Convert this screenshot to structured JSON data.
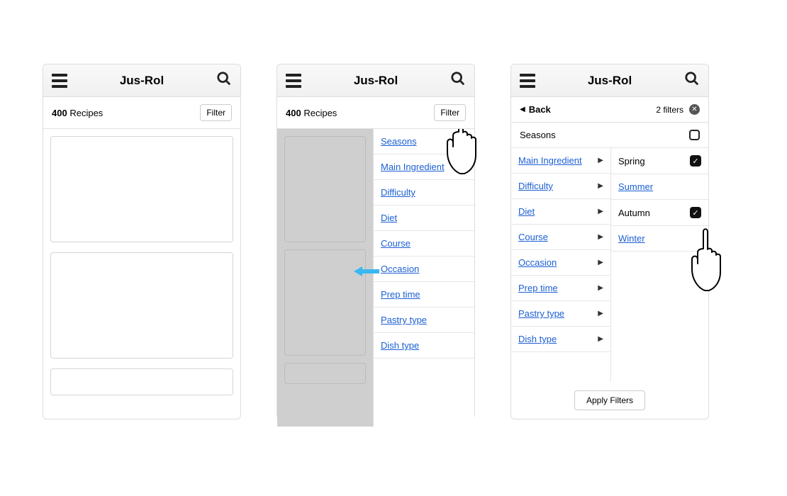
{
  "app": {
    "title": "Jus-Rol"
  },
  "recipes": {
    "count": "400",
    "label": "Recipes",
    "filter_label": "Filter"
  },
  "categories": [
    "Seasons",
    "Main Ingredient",
    "Difficulty",
    "Diet",
    "Course",
    "Occasion",
    "Prep time",
    "Pastry type",
    "Dish type"
  ],
  "screen3": {
    "back_label": "Back",
    "filter_count_label": "2 filters",
    "heading": "Seasons",
    "left_categories": [
      "Main Ingredient",
      "Difficulty",
      "Diet",
      "Course",
      "Occasion",
      "Prep time",
      "Pastry type",
      "Dish type"
    ],
    "seasons": [
      {
        "label": "Spring",
        "checked": true,
        "link": false
      },
      {
        "label": "Summer",
        "checked": false,
        "link": true
      },
      {
        "label": "Autumn",
        "checked": true,
        "link": false
      },
      {
        "label": "Winter",
        "checked": false,
        "link": true
      }
    ],
    "apply_label": "Apply Filters"
  }
}
